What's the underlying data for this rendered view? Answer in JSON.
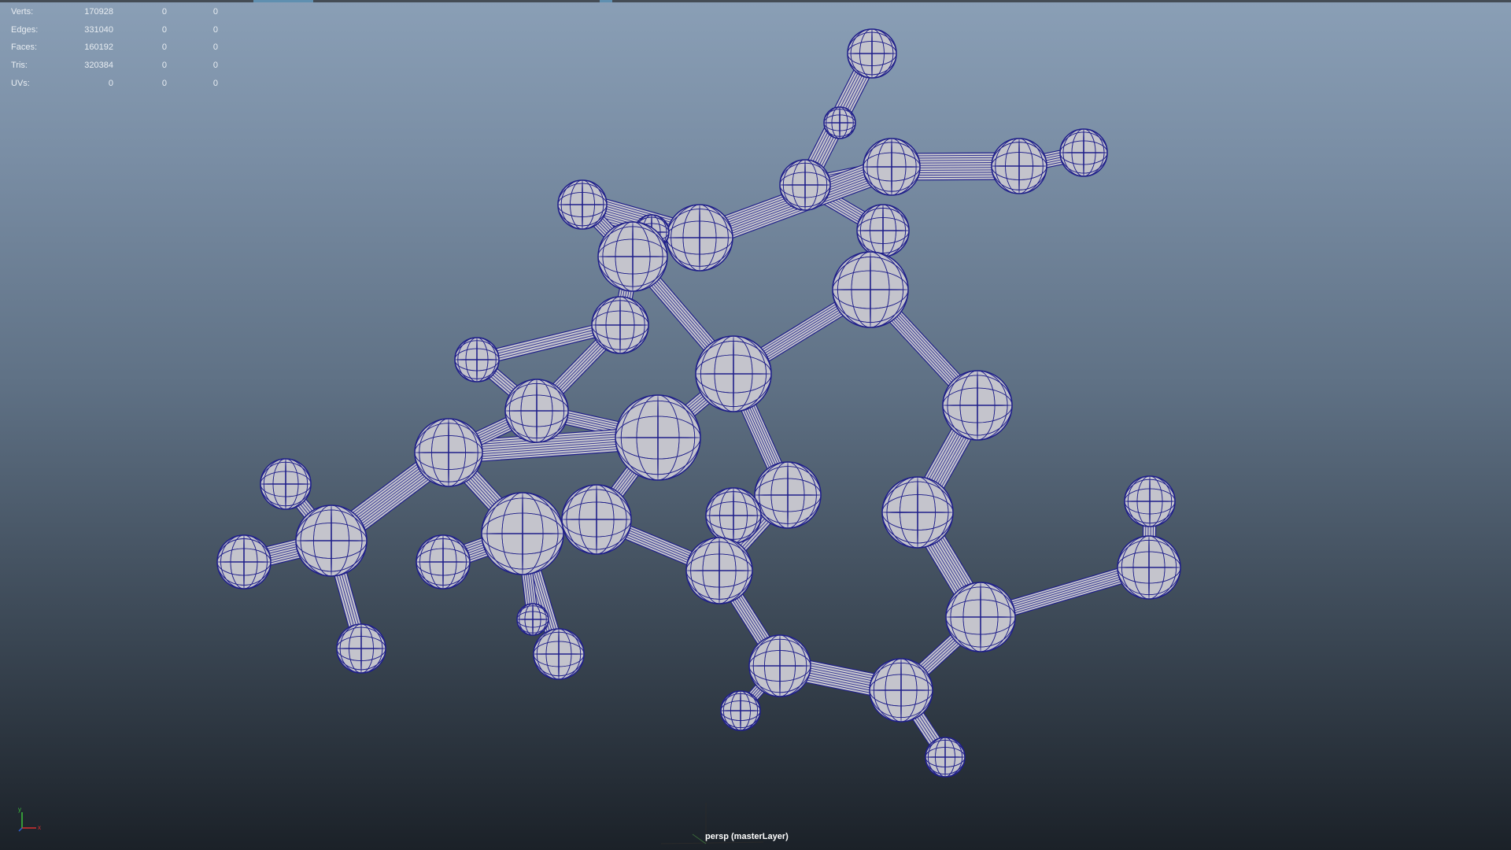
{
  "hud": {
    "rows": [
      {
        "label": "Verts:",
        "v1": "170928",
        "v2": "0",
        "v3": "0"
      },
      {
        "label": "Edges:",
        "v1": "331040",
        "v2": "0",
        "v3": "0"
      },
      {
        "label": "Faces:",
        "v1": "160192",
        "v2": "0",
        "v3": "0"
      },
      {
        "label": "Tris:",
        "v1": "320384",
        "v2": "0",
        "v3": "0"
      },
      {
        "label": "UVs:",
        "v1": "0",
        "v2": "0",
        "v3": "0"
      }
    ]
  },
  "viewport": {
    "camera_label": "persp (masterLayer)",
    "axis_y_label": "y",
    "axis_x_label": "x"
  },
  "colors": {
    "wire": "#1f1f8a",
    "atom_fill": "#c4c4cc",
    "axis_x": "#d63030",
    "axis_y": "#3cc03c"
  }
}
